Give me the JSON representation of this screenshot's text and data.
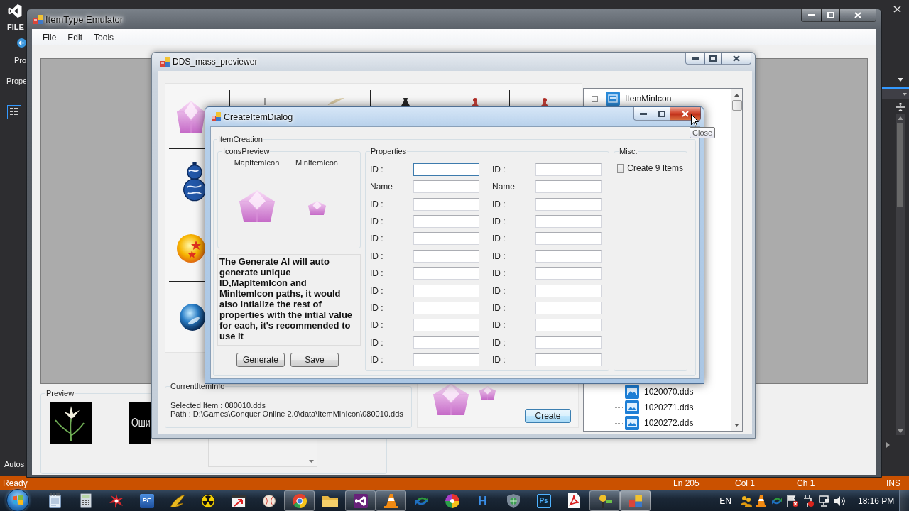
{
  "ide": {
    "menu_label": "FILE",
    "side_labels": [
      "Pro",
      "Prope"
    ],
    "bottom_label": "Autos",
    "status_bar": {
      "message": "Ready",
      "fields": [
        "Ln 205",
        "Col 1",
        "Ch 1",
        "INS"
      ]
    }
  },
  "main_window": {
    "title": "ItemType Emulator",
    "menu": [
      "File",
      "Edit",
      "Tools"
    ],
    "preview": {
      "title": "Preview",
      "images": [
        {
          "kind": "flower"
        },
        {
          "kind": "error_text",
          "text": "Оши"
        }
      ]
    }
  },
  "previewer_window": {
    "title": "DDS_mass_previewer",
    "grid": {
      "top_row": [
        {
          "kind": "stick"
        },
        {
          "kind": "feather"
        },
        {
          "kind": "vase"
        },
        {
          "kind": "bottle"
        },
        {
          "kind": "bottle"
        }
      ],
      "first_column": [
        {
          "kind": "gem"
        },
        {
          "kind": "gourd"
        },
        {
          "kind": "star_ball"
        },
        {
          "kind": "orb"
        }
      ]
    },
    "current_item_info": {
      "title": "CurrentItemInfo",
      "lines": [
        "Selected Item : 080010.dds",
        "Path : D:\\Games\\Conquer Online 2.0\\data\\ItemMinIcon\\080010.dds"
      ]
    },
    "create_button": "Create",
    "tree": {
      "root": {
        "label": "ItemMinIcon",
        "expanded": true
      },
      "files": [
        "1020070.dds",
        "1020271.dds",
        "1020272.dds"
      ]
    }
  },
  "dialog": {
    "title": "CreateItemDialog",
    "close_hovered": true,
    "tooltip": "Close",
    "group_title": "ItemCreation",
    "icons_preview": {
      "title": "IconsPreview",
      "columns": [
        "MapItemIcon",
        "MinItemIcon"
      ]
    },
    "description": "The Generate AI will auto generate unique ID,MapItemIcon and MinItemIcon paths, it would also intialize the rest of properties with the intial value for each, it's recommended to use it",
    "buttons": [
      "Generate",
      "Save"
    ],
    "properties": {
      "title": "Properties",
      "rows": [
        {
          "fields": [
            {
              "label": "ID :",
              "focused": true
            },
            {
              "label": "ID :",
              "focused": false
            }
          ]
        },
        {
          "fields": [
            {
              "label": "Name",
              "focused": false
            },
            {
              "label": "Name",
              "focused": false
            }
          ]
        },
        {
          "fields": [
            {
              "label": "ID :",
              "focused": false
            },
            {
              "label": "ID :",
              "focused": false
            }
          ]
        },
        {
          "fields": [
            {
              "label": "ID :",
              "focused": false
            },
            {
              "label": "ID :",
              "focused": false
            }
          ]
        },
        {
          "fields": [
            {
              "label": "ID :",
              "focused": false
            },
            {
              "label": "ID :",
              "focused": false
            }
          ]
        },
        {
          "fields": [
            {
              "label": "ID :",
              "focused": false
            },
            {
              "label": "ID :",
              "focused": false
            }
          ]
        },
        {
          "fields": [
            {
              "label": "ID :",
              "focused": false
            },
            {
              "label": "ID :",
              "focused": false
            }
          ]
        },
        {
          "fields": [
            {
              "label": "ID :",
              "focused": false
            },
            {
              "label": "ID :",
              "focused": false
            }
          ]
        },
        {
          "fields": [
            {
              "label": "ID :",
              "focused": false
            },
            {
              "label": "ID :",
              "focused": false
            }
          ]
        },
        {
          "fields": [
            {
              "label": "ID :",
              "focused": false
            },
            {
              "label": "ID :",
              "focused": false
            }
          ]
        },
        {
          "fields": [
            {
              "label": "ID :",
              "focused": false
            },
            {
              "label": "ID :",
              "focused": false
            }
          ]
        },
        {
          "fields": [
            {
              "label": "ID :",
              "focused": false
            },
            {
              "label": "ID :",
              "focused": false
            }
          ]
        }
      ]
    },
    "misc": {
      "title": "Misc.",
      "checkbox": {
        "label": "Create 9 Items",
        "checked": false
      }
    }
  },
  "taskbar": {
    "apps": [
      {
        "kind": "notepad",
        "running": false,
        "active": false
      },
      {
        "kind": "calculator",
        "running": false,
        "active": false
      },
      {
        "kind": "starburst",
        "running": false,
        "active": false
      },
      {
        "kind": "pe_badge",
        "label": "PE",
        "running": false,
        "active": false
      },
      {
        "kind": "wing",
        "running": false,
        "active": false
      },
      {
        "kind": "radiation",
        "running": false,
        "active": false
      },
      {
        "kind": "window_arrow",
        "running": false,
        "active": false
      },
      {
        "kind": "ball",
        "running": false,
        "active": false
      },
      {
        "kind": "ring",
        "running": true,
        "active": false
      },
      {
        "kind": "folder",
        "running": false,
        "active": false
      },
      {
        "kind": "ribbon",
        "running": true,
        "active": false
      },
      {
        "kind": "cone",
        "running": true,
        "active": false
      },
      {
        "kind": "arrows",
        "running": false,
        "active": false
      },
      {
        "kind": "swirl",
        "running": false,
        "active": false
      },
      {
        "kind": "letter_h",
        "label": "H",
        "running": false,
        "active": false
      },
      {
        "kind": "shield",
        "running": false,
        "active": false
      },
      {
        "kind": "ps_tile",
        "label": "Ps",
        "running": false,
        "active": false
      },
      {
        "kind": "pdf",
        "running": false,
        "active": false
      },
      {
        "kind": "bars",
        "running": true,
        "active": false
      },
      {
        "kind": "app_window",
        "running": true,
        "active": true
      }
    ],
    "language": "EN",
    "clock": "18:16 PM"
  }
}
